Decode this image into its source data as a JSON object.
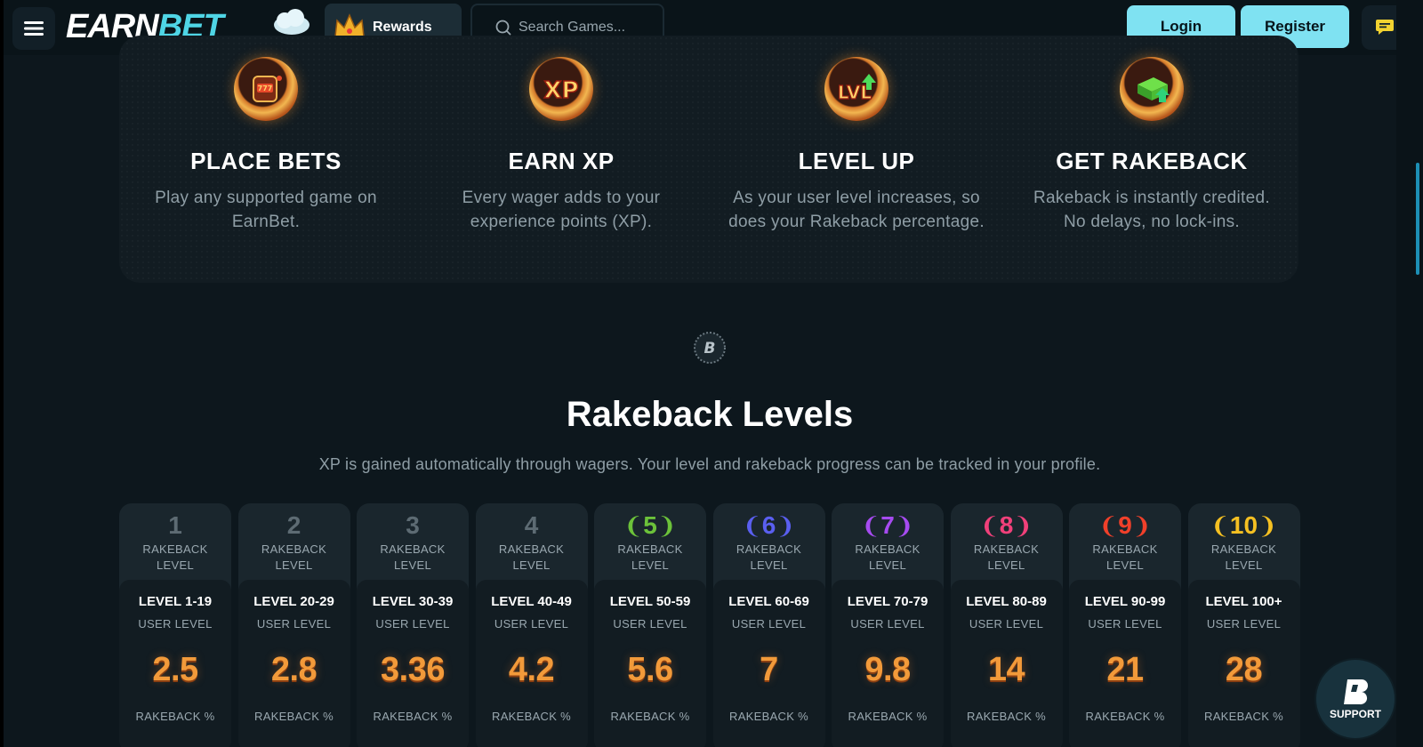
{
  "header": {
    "logo_earn": "EARN",
    "logo_bet": "BET",
    "rewards_label": "Rewards",
    "search_placeholder": "Search Games...",
    "login_label": "Login",
    "register_label": "Register"
  },
  "steps": [
    {
      "icon": "slot-machine-icon",
      "title": "PLACE BETS",
      "desc": "Play any supported game on EarnBet."
    },
    {
      "icon": "xp-badge-icon",
      "title": "EARN XP",
      "desc": "Every wager adds to your experience points (XP)."
    },
    {
      "icon": "level-up-icon",
      "title": "LEVEL UP",
      "desc": "As your user level increases, so does your Rakeback percentage."
    },
    {
      "icon": "cash-rakeback-icon",
      "title": "GET RAKEBACK",
      "desc": "Rakeback is instantly credited. No delays, no lock-ins."
    }
  ],
  "section": {
    "title": "Rakeback Levels",
    "subtitle": "XP is gained automatically through wagers. Your level and rakeback progress can be tracked in your profile."
  },
  "card_labels": {
    "rakeback_1": "RAKEBACK",
    "rakeback_2": "LEVEL",
    "user_level": "USER LEVEL",
    "rakeback_pct": "RAKEBACK %"
  },
  "levels": [
    {
      "rank": "1",
      "color": "#5d6b73",
      "laurel": false,
      "user_level": "LEVEL 1-19",
      "rakeback": "2.5"
    },
    {
      "rank": "2",
      "color": "#5d6b73",
      "laurel": false,
      "user_level": "LEVEL 20-29",
      "rakeback": "2.8"
    },
    {
      "rank": "3",
      "color": "#5d6b73",
      "laurel": false,
      "user_level": "LEVEL 30-39",
      "rakeback": "3.36"
    },
    {
      "rank": "4",
      "color": "#5d6b73",
      "laurel": false,
      "user_level": "LEVEL 40-49",
      "rakeback": "4.2"
    },
    {
      "rank": "5",
      "color": "#6cc23a",
      "laurel": true,
      "user_level": "LEVEL 50-59",
      "rakeback": "5.6"
    },
    {
      "rank": "6",
      "color": "#5a5ff0",
      "laurel": true,
      "user_level": "LEVEL 60-69",
      "rakeback": "7"
    },
    {
      "rank": "7",
      "color": "#a64bf0",
      "laurel": true,
      "user_level": "LEVEL 70-79",
      "rakeback": "9.8"
    },
    {
      "rank": "8",
      "color": "#f0407a",
      "laurel": true,
      "user_level": "LEVEL 80-89",
      "rakeback": "14"
    },
    {
      "rank": "9",
      "color": "#f0402a",
      "laurel": true,
      "user_level": "LEVEL 90-99",
      "rakeback": "21"
    },
    {
      "rank": "10",
      "color": "#f5c022",
      "laurel": true,
      "user_level": "LEVEL 100+",
      "rakeback": "28"
    }
  ],
  "support_label": "SUPPORT",
  "colors": {
    "accent": "#7fe2f2",
    "background": "#0d171d",
    "rakeback_orange": "#f29a3a"
  }
}
